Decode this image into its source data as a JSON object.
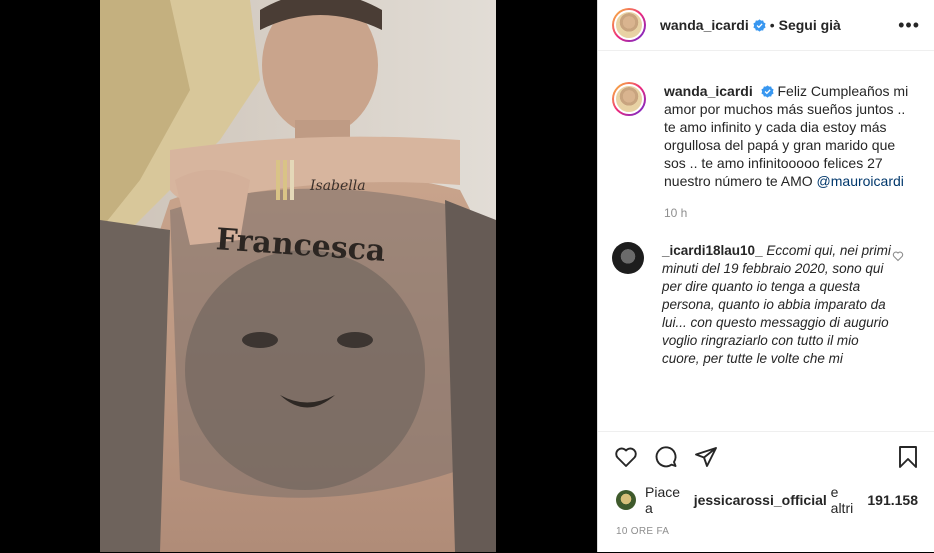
{
  "post_image": {
    "tattoo_chest": "Francesca",
    "tattoo_arm": "Isabella"
  },
  "header": {
    "username": "wanda_icardi",
    "separator": "•",
    "follow_status": "Segui già",
    "more": "•••"
  },
  "caption": {
    "username": "wanda_icardi",
    "text": "Feliz Cumpleaños mi amor por muchos más sueños juntos .. te amo infinito y cada dia estoy más orgullosa del papá y gran marido que sos .. te amo infinitooooo felices 27 nuestro número te AMO",
    "mention": "@mauroicardi",
    "time": "10 h"
  },
  "comment": {
    "username": "_icardi18lau10_",
    "text": "Eccomi qui, nei primi minuti del 19 febbraio 2020, sono qui per dire quanto io tenga a questa persona, quanto io abbia imparato da lui... con questo messaggio di augurio voglio ringraziarlo con tutto il mio cuore, per tutte le volte che mi"
  },
  "likes": {
    "prefix": "Piace a",
    "user": "jessicarossi_official",
    "middle": "e altri",
    "count": "191.158"
  },
  "date": "10 ORE FA",
  "icons": [
    "heart-icon",
    "comment-icon",
    "share-icon",
    "bookmark-icon",
    "verified-icon",
    "more-icon"
  ],
  "colors": {
    "text": "#262626",
    "secondary": "#8e8e8e",
    "verified": "#3897f0",
    "mention": "#00376b"
  }
}
